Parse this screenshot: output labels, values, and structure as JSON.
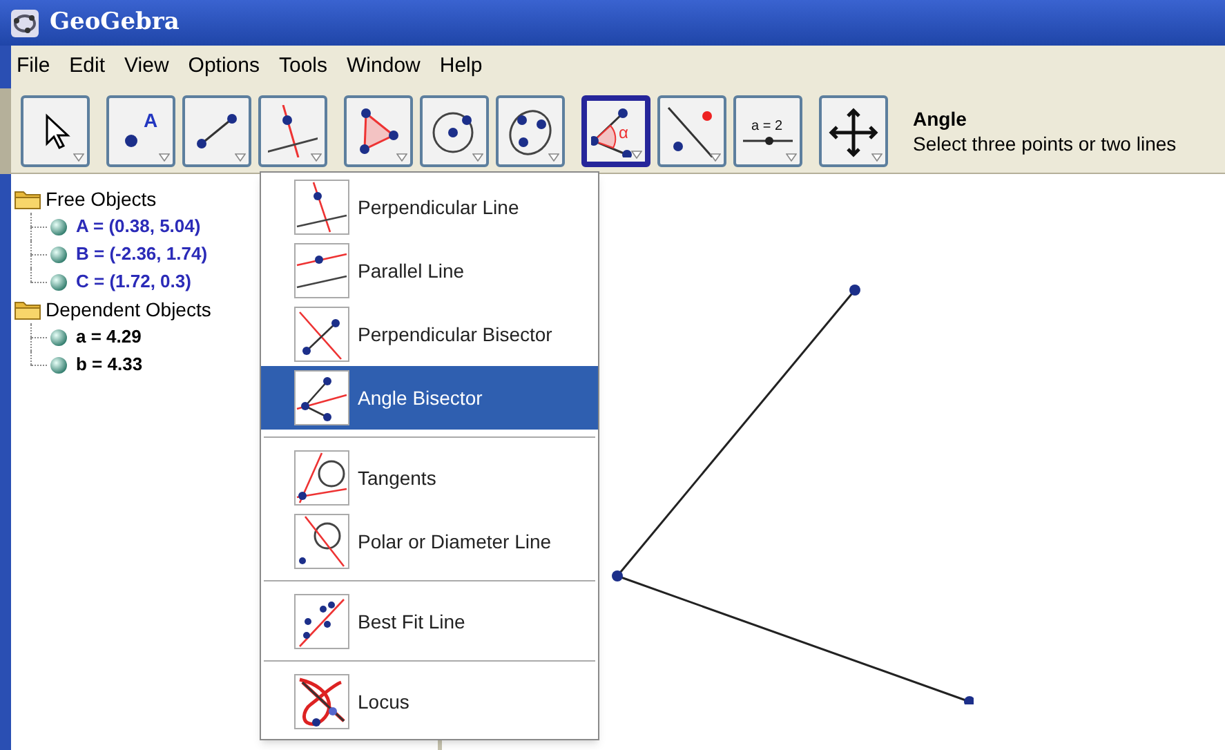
{
  "window": {
    "title": "GeoGebra"
  },
  "menu_bar": [
    "File",
    "Edit",
    "View",
    "Options",
    "Tools",
    "Window",
    "Help"
  ],
  "toolbar": {
    "groups": [
      [
        {
          "selected": false
        }
      ],
      [
        {
          "selected": false,
          "icon_text": "A"
        },
        {
          "selected": false
        },
        {
          "selected": false
        }
      ],
      [
        {
          "selected": false
        },
        {
          "selected": false
        },
        {
          "selected": false
        }
      ],
      [
        {
          "selected": true,
          "icon_text": "α"
        },
        {
          "selected": false
        },
        {
          "selected": false,
          "icon_text": "a = 2"
        }
      ],
      [
        {
          "selected": false
        }
      ]
    ],
    "tool_name": "Angle",
    "tool_help": "Select three points or two lines"
  },
  "algebra_view": [
    {
      "label": "Free Objects",
      "kind": "free",
      "children": [
        {
          "label": "A = (0.38, 5.04)"
        },
        {
          "label": "B = (-2.36, 1.74)"
        },
        {
          "label": "C = (1.72, 0.3)"
        }
      ]
    },
    {
      "label": "Dependent Objects",
      "kind": "dependent",
      "children": [
        {
          "label": "a = 4.29"
        },
        {
          "label": "b = 4.33"
        }
      ]
    }
  ],
  "tool_menu": [
    [
      {
        "label": "Perpendicular Line",
        "selected": false
      },
      {
        "label": "Parallel Line",
        "selected": false
      },
      {
        "label": "Perpendicular Bisector",
        "selected": false
      },
      {
        "label": "Angle Bisector",
        "selected": true
      }
    ],
    [
      {
        "label": "Tangents",
        "selected": false
      },
      {
        "label": "Polar or Diameter Line",
        "selected": false
      }
    ],
    [
      {
        "label": "Best Fit Line",
        "selected": false
      }
    ],
    [
      {
        "label": "Locus",
        "selected": false
      }
    ]
  ]
}
